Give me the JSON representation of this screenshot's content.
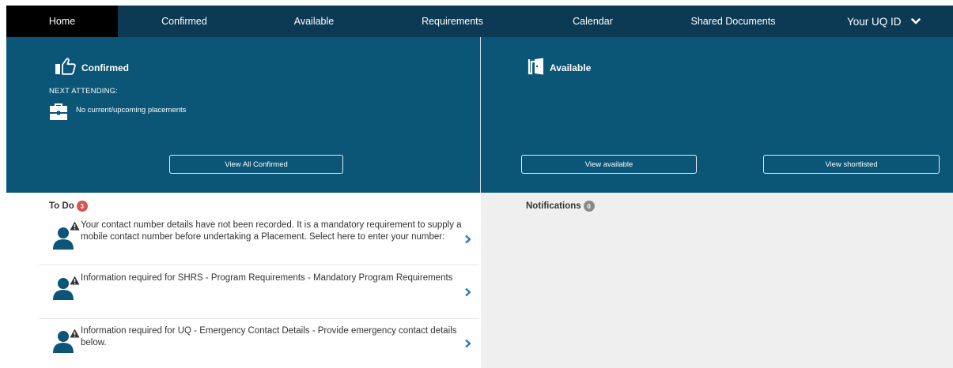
{
  "nav": {
    "items": [
      {
        "label": "Home",
        "active": true
      },
      {
        "label": "Confirmed"
      },
      {
        "label": "Available"
      },
      {
        "label": "Requirements"
      },
      {
        "label": "Calendar"
      },
      {
        "label": "Shared Documents"
      }
    ],
    "user_menu": {
      "label": "Your UQ ID",
      "icon": "chevron-down-icon"
    }
  },
  "confirmed_panel": {
    "title": "Confirmed",
    "icon": "thumbs-up-icon",
    "next_attending_label": "NEXT ATTENDING:",
    "placement_icon": "briefcase-icon",
    "placement_text": "No current/upcoming placements",
    "view_all_button": "View All Confirmed"
  },
  "available_panel": {
    "title": "Available",
    "icon": "door-icon",
    "view_available_button": "View available",
    "view_shortlisted_button": "View shortlisted"
  },
  "todo": {
    "title": "To Do",
    "count": "3",
    "items": [
      {
        "text": "Your contact number details have not been recorded. It is a mandatory requirement to supply a mobile contact number before undertaking a Placement. Select here to enter your number:"
      },
      {
        "text": "Information required for SHRS - Program Requirements - Mandatory Program Requirements"
      },
      {
        "text": "Information required for UQ - Emergency Contact Details - Provide emergency contact details below."
      }
    ]
  },
  "notifications": {
    "title": "Notifications",
    "count": "0"
  },
  "colors": {
    "nav_bg": "#0c3a55",
    "nav_active": "#000000",
    "hero_bg": "#0b5576",
    "todo_badge": "#d9534f",
    "notif_badge": "#8a8a8a",
    "notif_bg": "#efefef",
    "person_icon": "#0d5578",
    "chevron_accent": "#2a7ab8"
  }
}
